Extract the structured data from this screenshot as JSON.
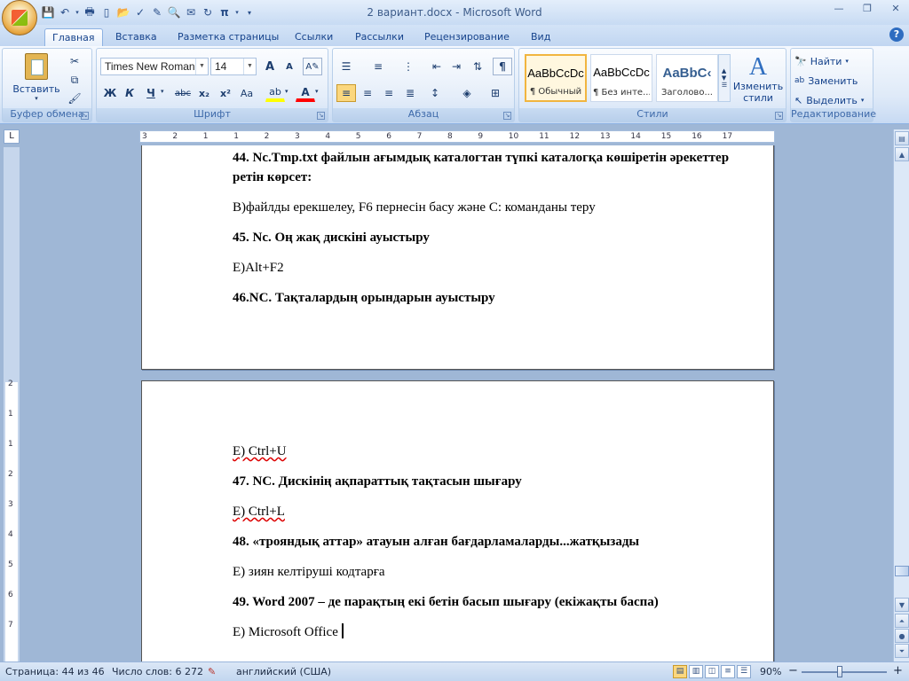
{
  "app": {
    "title": "2 вариант.docx - Microsoft Word"
  },
  "tabs": [
    "Главная",
    "Вставка",
    "Разметка страницы",
    "Ссылки",
    "Рассылки",
    "Рецензирование",
    "Вид"
  ],
  "ribbon": {
    "clipboard": {
      "label": "Буфер обмена",
      "paste": "Вставить"
    },
    "font": {
      "label": "Шрифт",
      "name": "Times New Roman",
      "size": "14",
      "bold": "Ж",
      "italic": "К",
      "underline": "Ч",
      "strike": "abc",
      "sub": "x₂",
      "sup": "x²",
      "case": "Aa",
      "grow": "A",
      "shrink": "A"
    },
    "paragraph": {
      "label": "Абзац"
    },
    "styles": {
      "label": "Стили",
      "items": [
        {
          "sample": "AaBbCcDc",
          "name": "¶ Обычный"
        },
        {
          "sample": "AaBbCcDc",
          "name": "¶ Без инте..."
        },
        {
          "sample": "AaBbC‹",
          "name": "Заголово..."
        }
      ],
      "change": "Изменить стили"
    },
    "editing": {
      "label": "Редактирование",
      "find": "Найти",
      "replace": "Заменить",
      "select": "Выделить"
    }
  },
  "ruler": {
    "h_numbers": [
      "3",
      "2",
      "1",
      "1",
      "2",
      "3",
      "4",
      "5",
      "6",
      "7",
      "8",
      "9",
      "10",
      "11",
      "12",
      "13",
      "14",
      "15",
      "16",
      "17"
    ],
    "v_numbers": [
      "2",
      "1",
      "1",
      "2",
      "3",
      "4",
      "5",
      "6",
      "7"
    ]
  },
  "doc": {
    "page1": [
      {
        "text": "44. Nc.Tmp.txt файлын ағымдық каталогтан түпкі каталогқа көшіретін әрекеттер ретін көрсет:",
        "bold": true
      },
      {
        "text": "B)файлды ерекшелеу, F6 пернесін басу және С: команданы теру",
        "bold": false
      },
      {
        "text": "45. Nc. Оң жақ дискіні ауыстыру",
        "bold": true
      },
      {
        "text": "E)Alt+F2",
        "bold": false
      },
      {
        "text": "46.NC. Тақталардың орындарын ауыстыру",
        "bold": true
      }
    ],
    "page2": [
      {
        "text": "E) Ctrl+U",
        "bold": false
      },
      {
        "text": "47. NC. Дискінің ақпараттық тақтасын шығару",
        "bold": true
      },
      {
        "text": "E) Ctrl+L",
        "bold": false
      },
      {
        "text": "48. «трояндық аттар» атауын алған бағдарламаларды...жатқызады",
        "bold": true
      },
      {
        "text": "E) зиян келтіруші кодтарға",
        "bold": false
      },
      {
        "text": "49. Word 2007 – де парақтың екі бетін басып шығару (екіжақты баспа)",
        "bold": true
      },
      {
        "text": "E) Microsoft Office",
        "bold": false
      }
    ]
  },
  "status": {
    "page": "Страница: 44 из 46",
    "words": "Число слов: 6 272",
    "lang": "английский (США)",
    "zoom": "90%",
    "minus": "−",
    "plus": "+"
  },
  "colors": {
    "accent": "#15428b",
    "ribbon_bg": "#dfeaf8",
    "doc_bg": "#9fb7d6",
    "highlight": "#ffff00",
    "font_color": "#ff0000"
  }
}
